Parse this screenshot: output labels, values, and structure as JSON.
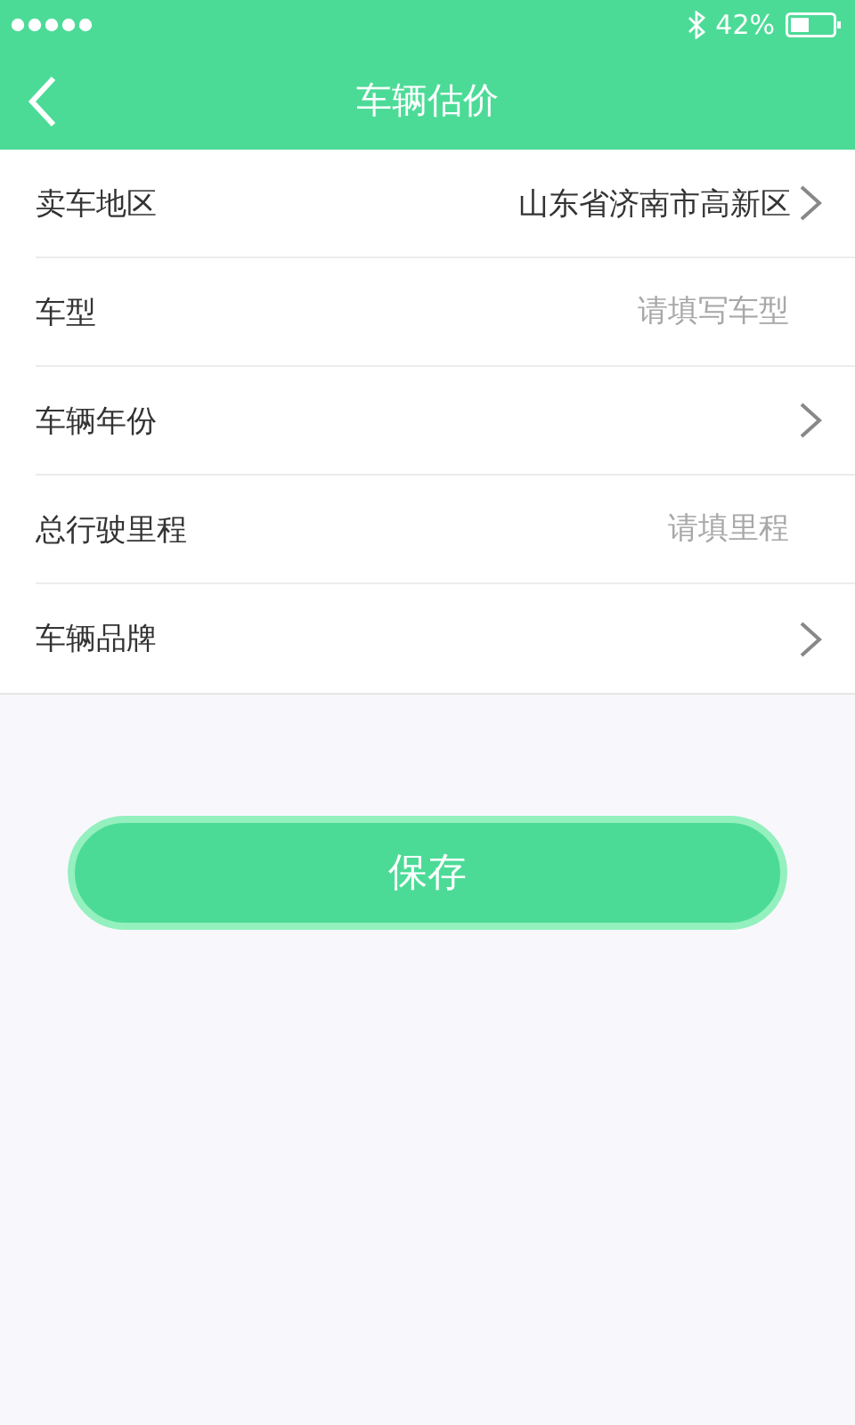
{
  "status_bar": {
    "battery": "42%"
  },
  "nav": {
    "title": "车辆估价"
  },
  "form": [
    {
      "kind": "select",
      "label": "卖车地区",
      "value": "山东省济南市高新区"
    },
    {
      "kind": "input",
      "label": "车型",
      "placeholder": "请填写车型"
    },
    {
      "kind": "select",
      "label": "车辆年份"
    },
    {
      "kind": "input",
      "label": "总行驶里程",
      "placeholder": "请填里程"
    },
    {
      "kind": "select",
      "label": "车辆品牌"
    }
  ],
  "save_button": "保存"
}
